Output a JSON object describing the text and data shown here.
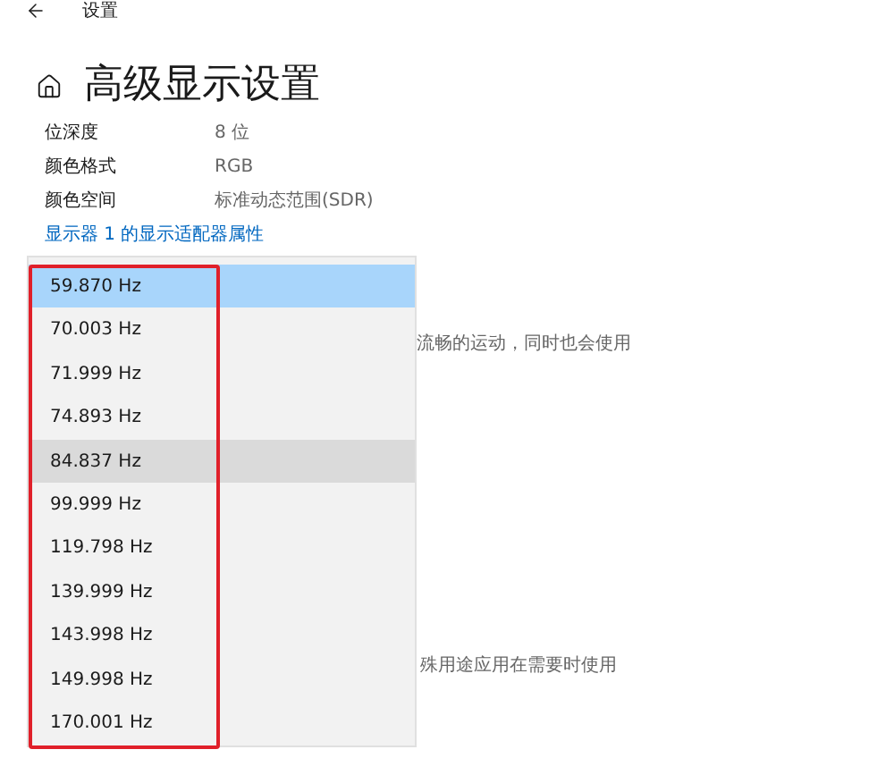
{
  "header": {
    "title": "设置"
  },
  "page": {
    "title": "高级显示设置"
  },
  "info_rows": [
    {
      "label": "位深度",
      "value": "8 位"
    },
    {
      "label": "颜色格式",
      "value": "RGB"
    },
    {
      "label": "颜色空间",
      "value": "标准动态范围(SDR)"
    }
  ],
  "link": "显示器 1 的显示适配器属性",
  "background_texts": [
    "流畅的运动，同时也会使用",
    "殊用途应用在需要时使用"
  ],
  "refresh_rate_menu": {
    "items": [
      {
        "label": "59.870 Hz",
        "selected": true,
        "hovered": false
      },
      {
        "label": "70.003 Hz",
        "selected": false,
        "hovered": false
      },
      {
        "label": "71.999 Hz",
        "selected": false,
        "hovered": false
      },
      {
        "label": "74.893 Hz",
        "selected": false,
        "hovered": false
      },
      {
        "label": "84.837 Hz",
        "selected": false,
        "hovered": true
      },
      {
        "label": "99.999 Hz",
        "selected": false,
        "hovered": false
      },
      {
        "label": "119.798 Hz",
        "selected": false,
        "hovered": false
      },
      {
        "label": "139.999 Hz",
        "selected": false,
        "hovered": false
      },
      {
        "label": "143.998 Hz",
        "selected": false,
        "hovered": false
      },
      {
        "label": "149.998 Hz",
        "selected": false,
        "hovered": false
      },
      {
        "label": "170.001 Hz",
        "selected": false,
        "hovered": false
      }
    ]
  }
}
